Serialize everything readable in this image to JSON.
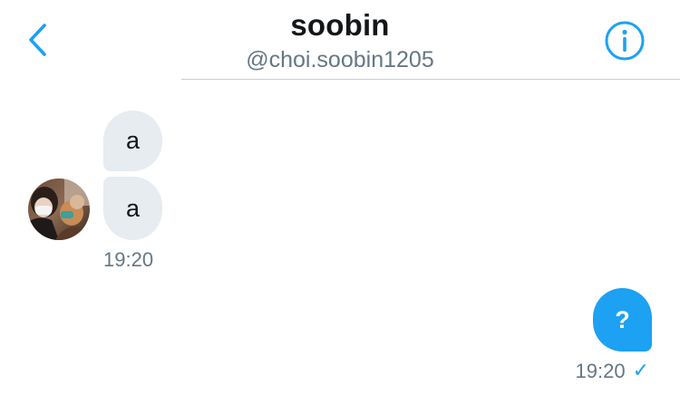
{
  "header": {
    "display_name": "soobin",
    "handle": "@choi.soobin1205",
    "back_icon": "chevron-left-icon",
    "info_icon": "info-icon"
  },
  "colors": {
    "accent": "#1da1f2",
    "incoming_bubble": "#e6ecf0",
    "text_primary": "#14171a",
    "text_secondary": "#657786"
  },
  "messages": {
    "incoming": [
      {
        "text": "a"
      },
      {
        "text": "a"
      }
    ],
    "incoming_timestamp": "19:20",
    "outgoing": [
      {
        "text": "?"
      }
    ],
    "outgoing_timestamp": "19:20",
    "outgoing_status_icon": "checkmark-icon"
  }
}
